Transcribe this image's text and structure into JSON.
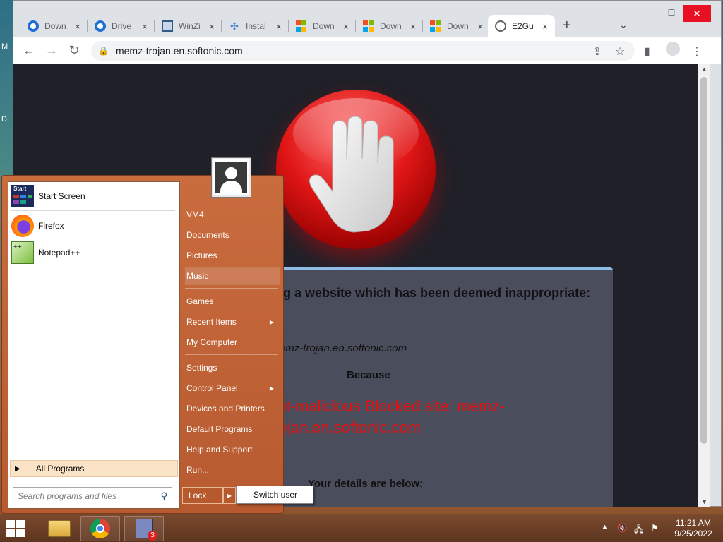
{
  "desktop": {
    "labels": [
      "M",
      "D"
    ]
  },
  "browser": {
    "tabs": [
      {
        "title": "Down",
        "icon": "edge-icon"
      },
      {
        "title": "Drive",
        "icon": "edge-icon"
      },
      {
        "title": "WinZi",
        "icon": "winzip-icon"
      },
      {
        "title": "Instal",
        "icon": "installer-icon"
      },
      {
        "title": "Down",
        "icon": "microsoft-icon"
      },
      {
        "title": "Down",
        "icon": "microsoft-icon"
      },
      {
        "title": "Down",
        "icon": "microsoft-icon"
      },
      {
        "title": "E2Gu",
        "icon": "globe-icon"
      }
    ],
    "tab_close": "×",
    "new_tab": "+",
    "tab_menu": "⌄",
    "minimize": "—",
    "maximize": "□",
    "close": "✕",
    "back": "←",
    "forward": "→",
    "reload": "↻",
    "url": "memz-trojan.en.softonic.com",
    "share": "⇪",
    "star": "☆",
    "sidepanel": "▮",
    "menu": "⋮"
  },
  "blockpage": {
    "heading": "g a website which has been deemed inappropriate:",
    "url": "://memz-trojan.en.softonic.com",
    "because_label": "Because",
    "reason": "net-malicious  Blocked site: memz-trojan.en.softonic.com",
    "details_label": "Your details are below:"
  },
  "startmenu": {
    "pinned": [
      {
        "label": "Start Screen",
        "icon": "start-screen-icon"
      },
      {
        "label": "Firefox",
        "icon": "firefox-icon"
      },
      {
        "label": "Notepad++",
        "icon": "notepadpp-icon"
      }
    ],
    "start_tile_text": "Start",
    "all_programs": "All Programs",
    "search_placeholder": "Search programs and files",
    "right_items": [
      {
        "label": "VM4",
        "submenu": false
      },
      {
        "label": "Documents",
        "submenu": false
      },
      {
        "label": "Pictures",
        "submenu": false
      },
      {
        "label": "Music",
        "submenu": false
      },
      {
        "label": "Games",
        "submenu": false
      },
      {
        "label": "Recent Items",
        "submenu": true
      },
      {
        "label": "My Computer",
        "submenu": false
      },
      {
        "label": "Settings",
        "submenu": false
      },
      {
        "label": "Control Panel",
        "submenu": true
      },
      {
        "label": "Devices and Printers",
        "submenu": false
      },
      {
        "label": "Default Programs",
        "submenu": false
      },
      {
        "label": "Help and Support",
        "submenu": false
      },
      {
        "label": "Run...",
        "submenu": false
      }
    ],
    "lock": "Lock",
    "switch_user": "Switch user"
  },
  "taskbar": {
    "apps": [
      "file-explorer-icon",
      "chrome-icon",
      "task-app-icon"
    ],
    "badge": "3",
    "time": "11:21 AM",
    "date": "9/25/2022"
  },
  "colors": {
    "accent": "#b75a30",
    "blocked_red": "#e01010"
  }
}
